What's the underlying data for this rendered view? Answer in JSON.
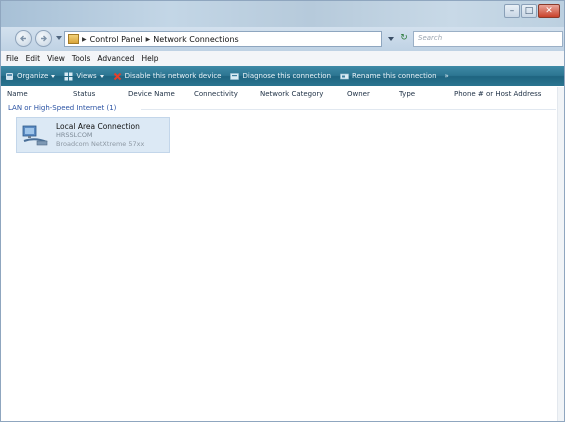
{
  "window": {
    "title": ""
  },
  "address_bar": {
    "breadcrumbs": [
      "Control Panel",
      "Network Connections"
    ],
    "search_placeholder": "Search"
  },
  "menu": [
    "File",
    "Edit",
    "View",
    "Tools",
    "Advanced",
    "Help"
  ],
  "toolbar": {
    "organize": "Organize",
    "views": "Views",
    "disable": "Disable this network device",
    "diagnose": "Diagnose this connection",
    "rename": "Rename this connection",
    "more": "»"
  },
  "columns": [
    "Name",
    "Status",
    "Device Name",
    "Connectivity",
    "Network Category",
    "Owner",
    "Type",
    "Phone # or Host Address"
  ],
  "group": {
    "header": "LAN or High-Speed Internet (1)",
    "items": [
      {
        "name": "Local Area Connection",
        "device": "HRSSLCOM",
        "adapter": "Broadcom NetXtreme 57xx",
        "icon": "network-adapter-icon"
      }
    ]
  },
  "colors": {
    "toolbar": "#2c7592",
    "group_header": "#2a52a3",
    "selection": "#dce9f5"
  }
}
